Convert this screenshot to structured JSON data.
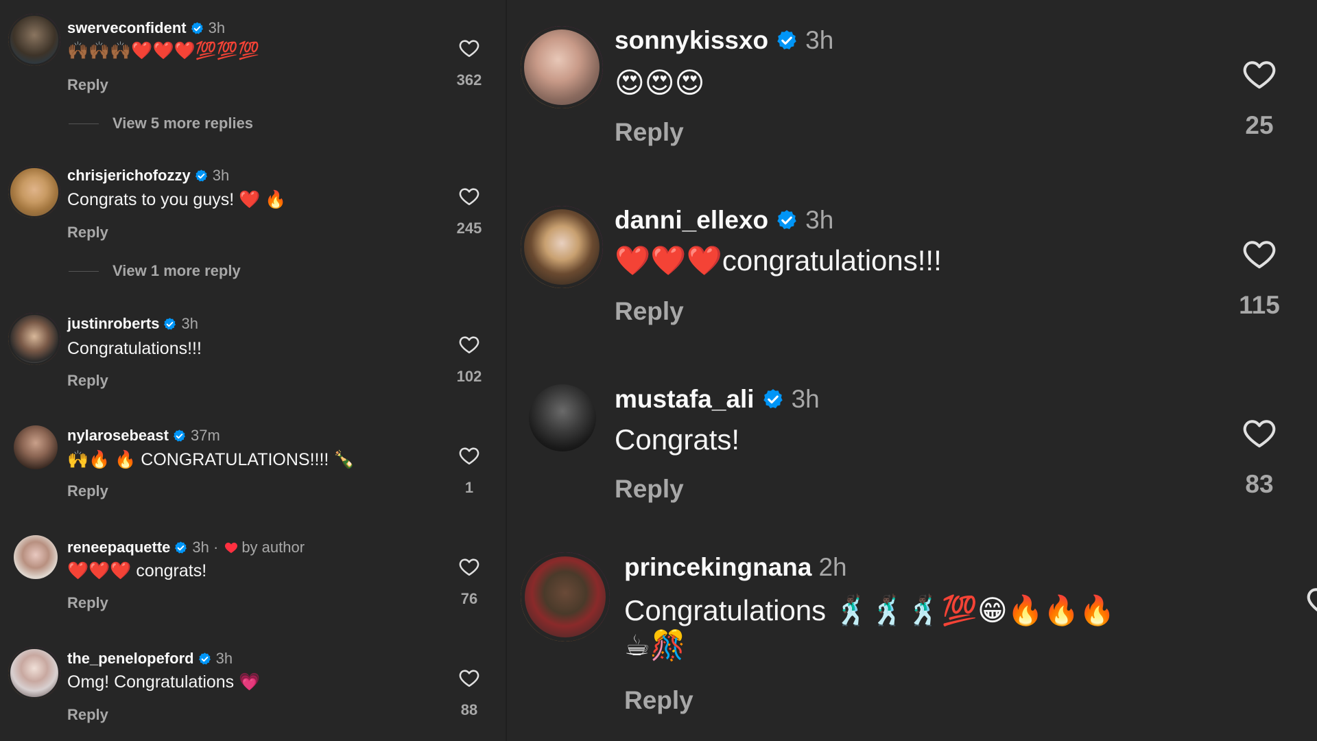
{
  "left_comments": [
    {
      "username": "swerveconfident",
      "time": "3h",
      "text": "🙌🏾🙌🏾🙌🏾❤️❤️❤️💯💯💯",
      "reply": "Reply",
      "likes": "362",
      "view_more": "View 5 more replies"
    },
    {
      "username": "chrisjerichofozzy",
      "time": "3h",
      "text": "Congrats to you guys! ❤️ 🔥",
      "reply": "Reply",
      "likes": "245",
      "view_more": "View 1 more reply"
    },
    {
      "username": "justinroberts",
      "time": "3h",
      "text": "Congratulations!!!",
      "reply": "Reply",
      "likes": "102"
    },
    {
      "username": "nylarosebeast",
      "time": "37m",
      "text": "🙌🔥 🔥 CONGRATULATIONS!!!! 🍾",
      "reply": "Reply",
      "likes": "1"
    },
    {
      "username": "reneepaquette",
      "time": "3h ·",
      "by_author": "by author",
      "text": "❤️❤️❤️ congrats!",
      "reply": "Reply",
      "likes": "76"
    },
    {
      "username": "the_penelopeford",
      "time": "3h",
      "text": "Omg! Congratulations 💗",
      "reply": "Reply",
      "likes": "88"
    }
  ],
  "right_comments": [
    {
      "username": "sonnykissxo",
      "time": "3h",
      "text": "😍😍😍",
      "reply": "Reply",
      "likes": "25"
    },
    {
      "username": "danni_ellexo",
      "time": "3h",
      "text": "❤️❤️❤️congratulations!!!",
      "reply": "Reply",
      "likes": "115"
    },
    {
      "username": "mustafa_ali",
      "time": "3h",
      "text": "Congrats!",
      "reply": "Reply",
      "likes": "83"
    },
    {
      "username": "princekingnana",
      "time": "2h",
      "text": "Congratulations 🕺🏿🕺🏿🕺🏿💯😁🔥🔥🔥",
      "text2": "☕🎊",
      "reply": "Reply"
    }
  ],
  "colors": {
    "background": "#262626",
    "verified": "#0095f6",
    "secondary_text": "#a8a8a8",
    "heart_author": "#ff3040"
  },
  "icons": {
    "like": "heart-outline-icon",
    "verified": "verified-badge-icon",
    "author_like": "heart-filled-icon"
  }
}
